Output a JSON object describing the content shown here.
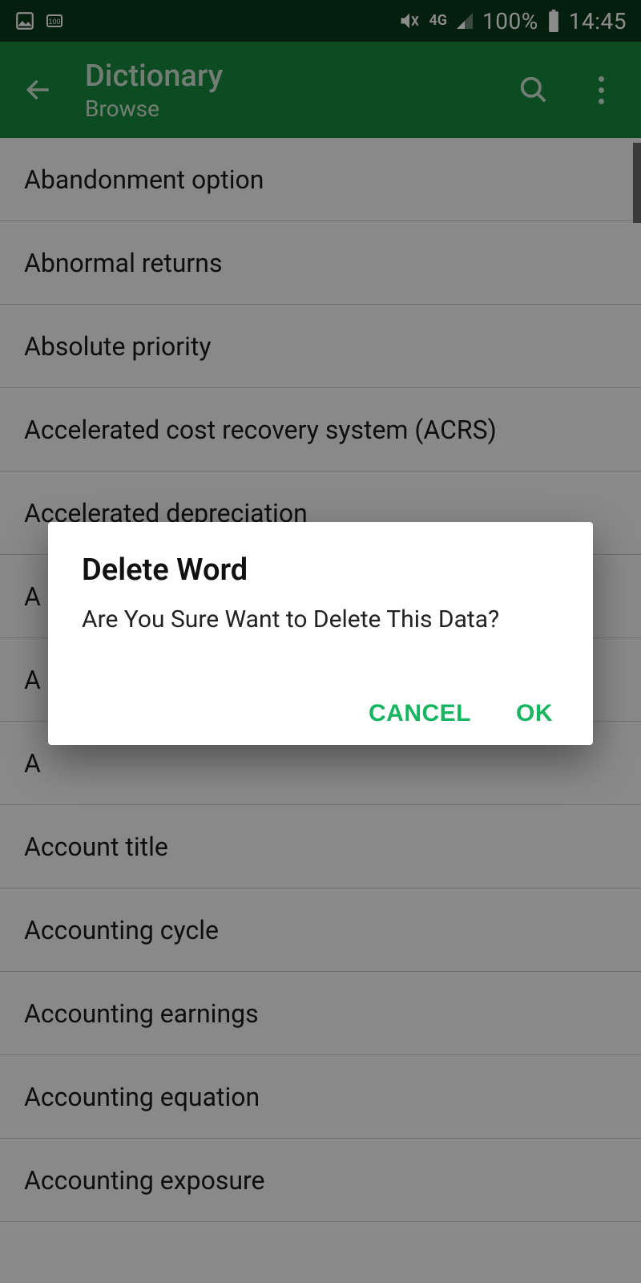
{
  "status": {
    "network_label": "4G",
    "battery_percent": "100%",
    "time": "14:45"
  },
  "header": {
    "title": "Dictionary",
    "subtitle": "Browse"
  },
  "list": {
    "items": [
      "Abandonment option",
      "Abnormal returns",
      "Absolute priority",
      "Accelerated cost recovery system (ACRS)",
      "Accelerated depreciation",
      "A",
      "A",
      "A",
      "Account title",
      "Accounting cycle",
      "Accounting earnings",
      "Accounting equation",
      "Accounting exposure"
    ]
  },
  "dialog": {
    "title": "Delete Word",
    "message": "Are You Sure Want to Delete This Data?",
    "cancel_label": "CANCEL",
    "ok_label": "OK"
  }
}
